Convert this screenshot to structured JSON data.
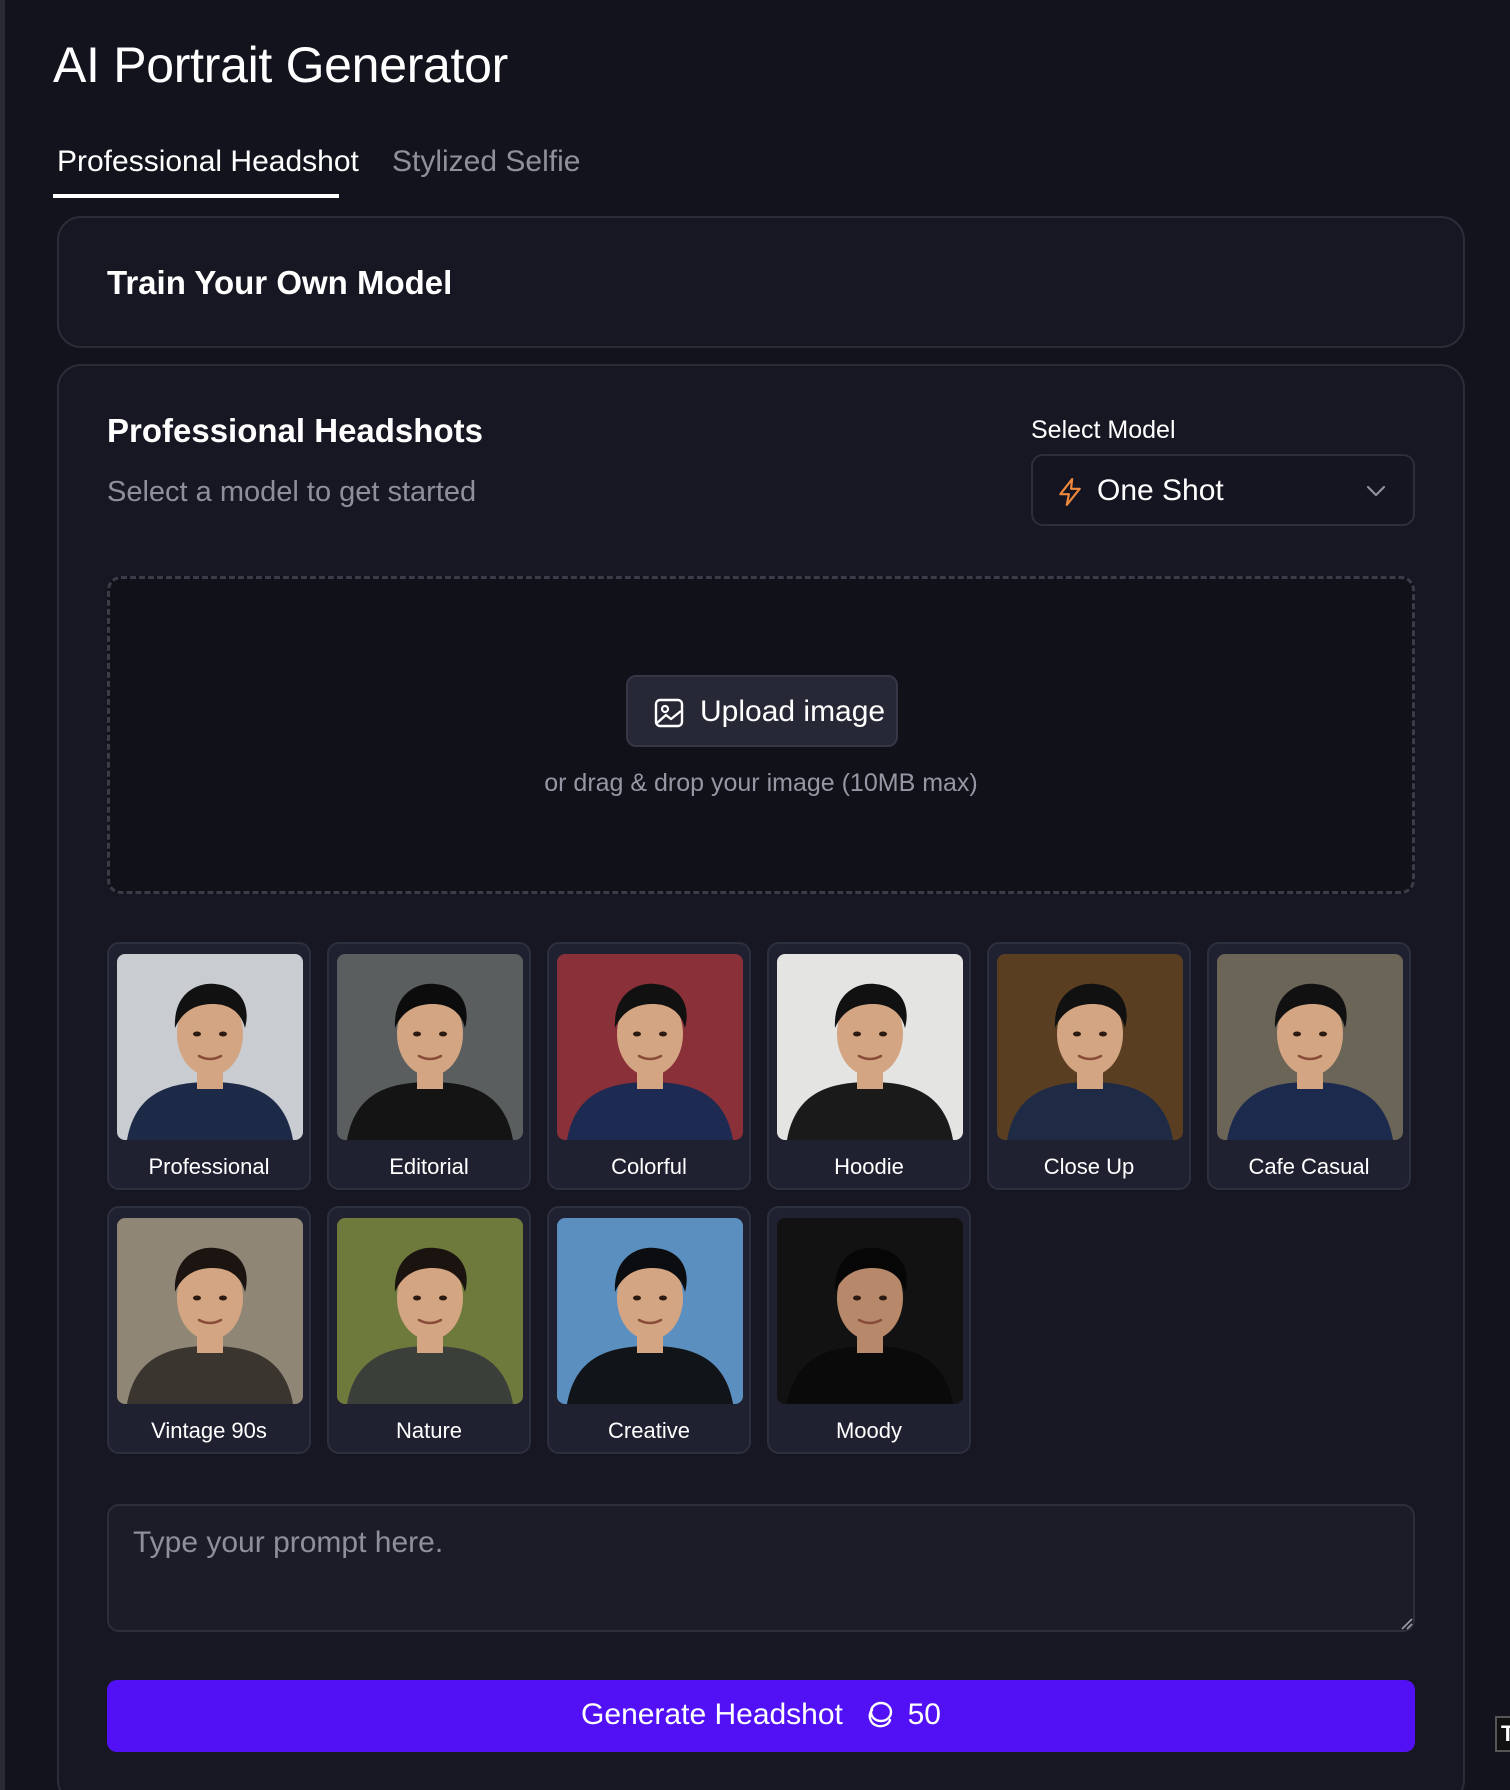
{
  "app": {
    "title": "AI Portrait Generator"
  },
  "tabs": [
    {
      "label": "Professional Headshot",
      "active": true
    },
    {
      "label": "Stylized Selfie",
      "active": false
    }
  ],
  "train_card": {
    "title": "Train Your Own Model"
  },
  "main": {
    "title": "Professional Headshots",
    "subtitle": "Select a model to get started",
    "model_select": {
      "label": "Select Model",
      "value": "One Shot",
      "icon": "bolt-icon"
    },
    "upload": {
      "button_label": "Upload image",
      "button_icon": "image-icon",
      "hint": "or drag & drop your image (10MB max)"
    },
    "styles": [
      {
        "label": "Professional",
        "bg": "#c9ccd0",
        "outfit": "#1d2a47",
        "hair": "#111"
      },
      {
        "label": "Editorial",
        "bg": "#5b5e5f",
        "outfit": "#141414",
        "hair": "#0c0c0c"
      },
      {
        "label": "Colorful",
        "bg": "#8a3038",
        "outfit": "#1d2a52",
        "hair": "#111"
      },
      {
        "label": "Hoodie",
        "bg": "#e4e4e2",
        "outfit": "#1a1a1a",
        "hair": "#111"
      },
      {
        "label": "Close Up",
        "bg": "#5a3e22",
        "outfit": "#1f2b45",
        "hair": "#111"
      },
      {
        "label": "Cafe Casual",
        "bg": "#6b6558",
        "outfit": "#1c2a4d",
        "hair": "#111"
      },
      {
        "label": "Vintage 90s",
        "bg": "#8f8676",
        "outfit": "#3b3530",
        "hair": "#1b1410"
      },
      {
        "label": "Nature",
        "bg": "#6d7a3c",
        "outfit": "#3a3f3a",
        "hair": "#1a130f"
      },
      {
        "label": "Creative",
        "bg": "#5b8fc0",
        "outfit": "#111418",
        "hair": "#0c0d10"
      },
      {
        "label": "Moody",
        "bg": "#121212",
        "outfit": "#0a0a0a",
        "hair": "#060606"
      }
    ],
    "prompt": {
      "placeholder": "Type your prompt here.",
      "value": ""
    },
    "generate": {
      "label": "Generate Headshot",
      "credits": "50",
      "icon": "credits-icon"
    }
  },
  "edge_chip": {
    "text": "T"
  },
  "colors": {
    "accent": "#5211f5",
    "bolt": "#f0883e",
    "background": "#12131c"
  }
}
